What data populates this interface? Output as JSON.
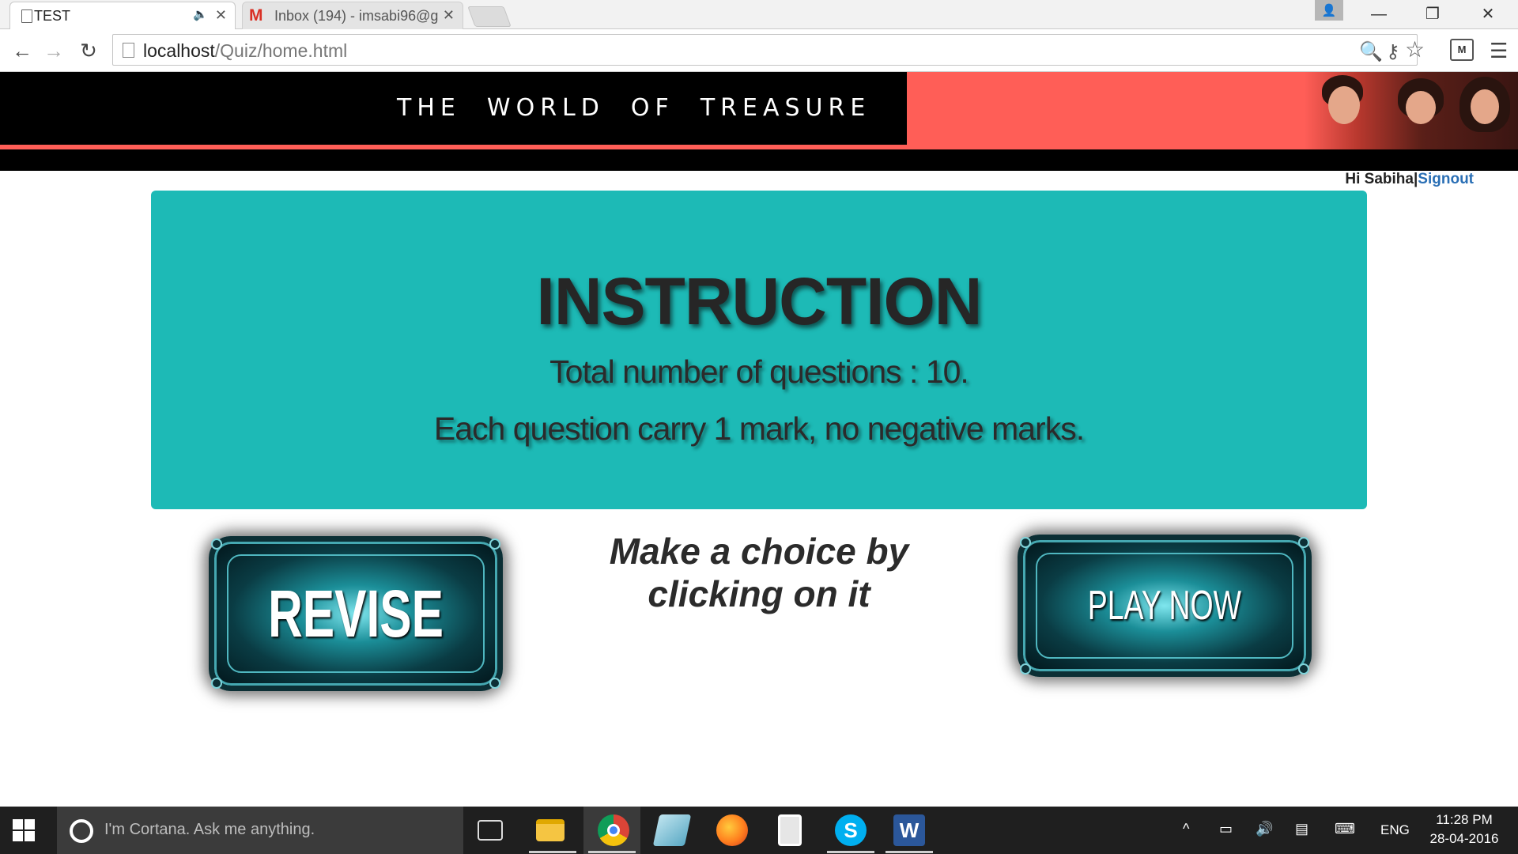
{
  "browser": {
    "tabs": [
      {
        "title": "TEST",
        "active": true
      },
      {
        "title": "Inbox (194) - imsabi96@g",
        "active": false
      }
    ],
    "address": {
      "host": "localhost",
      "path": "/Quiz/home.html"
    },
    "window_controls": {
      "minimize": "—",
      "restore": "❐",
      "close": "✕"
    }
  },
  "header": {
    "title": "THE  WORLD  OF  TREASURE",
    "colors": {
      "bar": "#000000",
      "accent": "#ff5e57"
    }
  },
  "user": {
    "greeting": "Hi Sabiha",
    "separator": "|",
    "signout": "Signout"
  },
  "instructions": {
    "title": "INSTRUCTION",
    "line1": "Total number of questions : 10.",
    "line2": "Each question carry 1 mark, no negative marks.",
    "panel_color": "#1dbab6"
  },
  "choices": {
    "prompt_line1": "Make a choice by",
    "prompt_line2": "clicking on it",
    "revise_label": "REVISE",
    "play_label": "PLAY NOW"
  },
  "taskbar": {
    "cortana_placeholder": "I'm Cortana. Ask me anything.",
    "language": "ENG",
    "time": "11:28 PM",
    "date": "28-04-2016",
    "pinned_icons": [
      "task-view-icon",
      "file-explorer-icon",
      "chrome-icon",
      "notepad-icon",
      "firefox-icon",
      "calculator-icon",
      "skype-icon",
      "word-icon"
    ]
  }
}
